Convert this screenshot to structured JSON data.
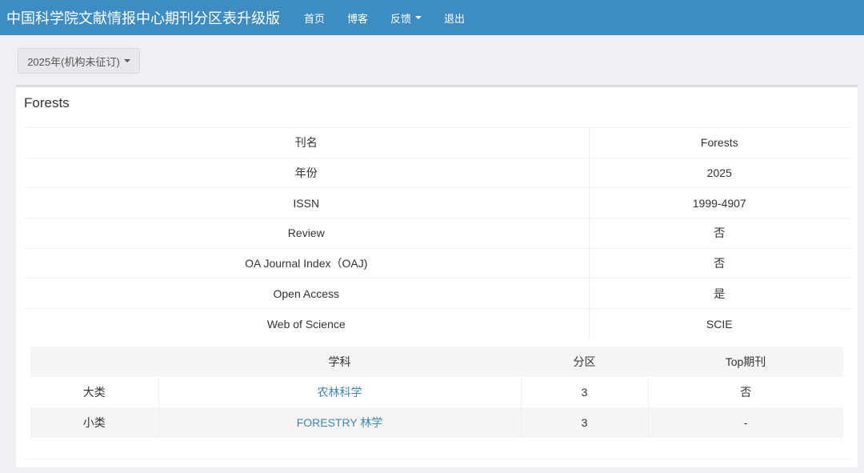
{
  "navbar": {
    "brand": "中国科学院文献情报中心期刊分区表升级版",
    "items": [
      {
        "label": "首页"
      },
      {
        "label": "博客"
      },
      {
        "label": "反馈"
      },
      {
        "label": "退出"
      }
    ]
  },
  "year_dropdown": {
    "label": "2025年(机构未征订)"
  },
  "panel": {
    "title": "Forests",
    "info_rows": [
      {
        "key": "刊名",
        "value": "Forests"
      },
      {
        "key": "年份",
        "value": "2025"
      },
      {
        "key": "ISSN",
        "value": "1999-4907"
      },
      {
        "key": "Review",
        "value": "否"
      },
      {
        "key": "OA Journal Index（OAJ)",
        "value": "否"
      },
      {
        "key": "Open Access",
        "value": "是"
      },
      {
        "key": "Web of Science",
        "value": "SCIE"
      }
    ],
    "subject_table": {
      "headers": [
        "",
        "学科",
        "分区",
        "Top期刊"
      ],
      "rows": [
        {
          "category": "大类",
          "subject": "农林科学",
          "zone": "3",
          "top": "否"
        },
        {
          "category": "小类",
          "subject": "FORESTRY 林学",
          "zone": "3",
          "top": "-"
        }
      ]
    }
  }
}
